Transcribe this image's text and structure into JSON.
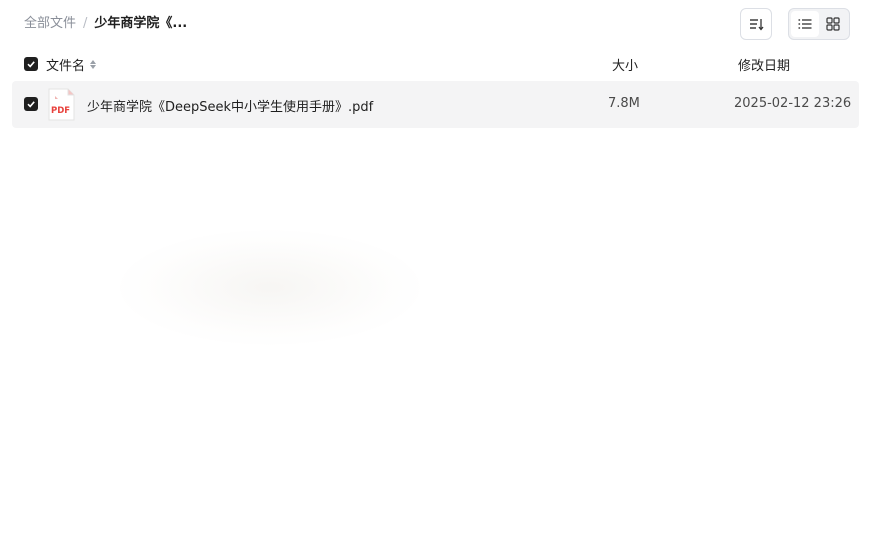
{
  "breadcrumb": {
    "root": "全部文件",
    "separator": "/",
    "current": "少年商学院《..."
  },
  "toolbar": {
    "sort_icon": "sort-icon",
    "list_view_icon": "list-view-icon",
    "grid_view_icon": "grid-view-icon",
    "active_view": "list"
  },
  "table": {
    "header": {
      "name": "文件名",
      "size": "大小",
      "date": "修改日期",
      "select_all_checked": true
    },
    "rows": [
      {
        "checked": true,
        "icon": "pdf-icon",
        "icon_label": "PDF",
        "name": "少年商学院《DeepSeek中小学生使用手册》.pdf",
        "size": "7.8M",
        "modified": "2025-02-12 23:26"
      }
    ]
  },
  "colors": {
    "checkbox": "#1f1f1f",
    "row_bg": "#f4f4f5",
    "pdf_red": "#e8413c"
  }
}
